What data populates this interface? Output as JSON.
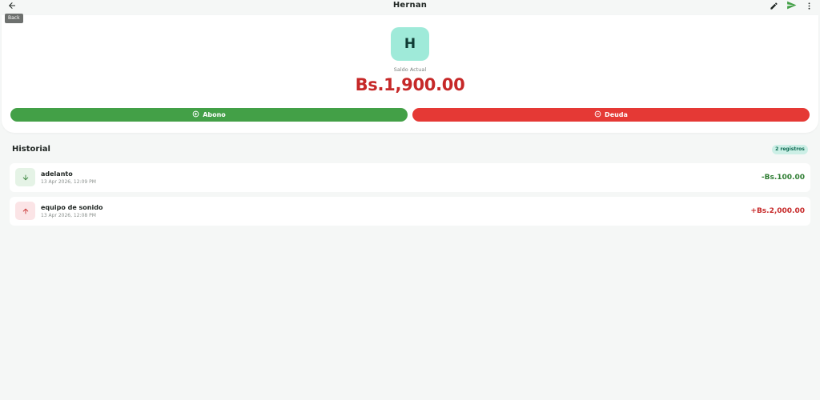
{
  "appbar": {
    "title": "Hernan",
    "back_tooltip": "Back",
    "icons": [
      "arrow-left-icon",
      "pencil-icon",
      "send-icon",
      "more-vert-icon"
    ]
  },
  "header": {
    "avatar_initial": "H",
    "balance_label": "Saldo Actual",
    "balance_amount": "Bs.1,900.00",
    "abono_label": "Abono",
    "deuda_label": "Deuda"
  },
  "history": {
    "title": "Historial",
    "count": "2 registros",
    "items": [
      {
        "name": "adelanto",
        "date": "13 Apr 2026, 12:09 PM",
        "amount": "-Bs.100.00",
        "direction": "down",
        "icon": "arrow-down-icon"
      },
      {
        "name": "equipo de sonido",
        "date": "13 Apr 2026, 12:08 PM",
        "amount": "+Bs.2,000.00",
        "direction": "up",
        "icon": "arrow-up-icon"
      }
    ]
  },
  "colors": {
    "accent_green": "#43a047",
    "accent_red": "#e53935",
    "balance_red": "#c62828",
    "avatar_bg": "#9fead9",
    "badge_bg": "#ccefe6"
  }
}
